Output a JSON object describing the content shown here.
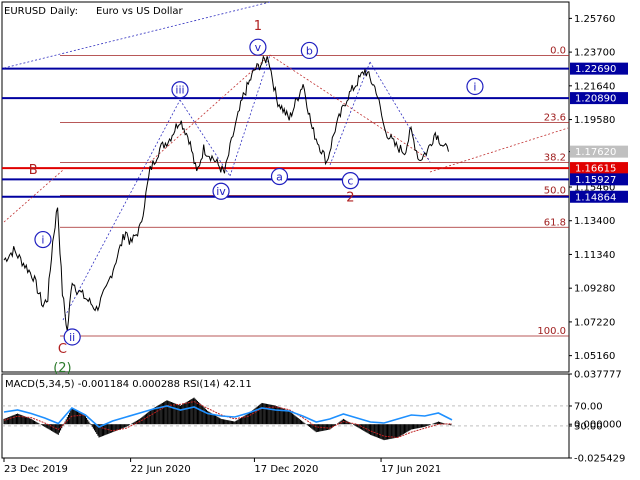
{
  "header": {
    "symbol": "EURUSD",
    "timeframe": "Daily:",
    "description": "Euro vs US Dollar"
  },
  "colors": {
    "bg": "#ffffff",
    "price": "#000000",
    "level_blue": "#0000a0",
    "level_red": "#e00000",
    "fib": "#a02020",
    "wave_blue": "#2020c0",
    "wave_red": "#b02020",
    "wave_green": "#2a7a2a",
    "dotted_blue": "#3030c0",
    "dotted_red": "#c03030",
    "macd_hist": "#000000",
    "signal": "#c02020",
    "rsi": "#1e90ff",
    "label_bg": "#0000a0",
    "label_red_bg": "#e00000",
    "label_gray_bg": "#c0c0c0"
  },
  "chart_data": [
    {
      "type": "line",
      "title": "EURUSD, Daily:  Euro vs US Dollar",
      "x": [
        "23 Dec 2019",
        "22 Jun 2020",
        "17 Dec 2020",
        "17 Jun 2021"
      ],
      "x_ticks": [
        "23 Dec 2019",
        "22 Jun 2020",
        "17 Dec 2020",
        "17 Jun 2021"
      ],
      "y_ticks": [
        "1.25760",
        "1.23700",
        "1.21640",
        "1.19580",
        "1.17620",
        "1.15460",
        "1.13400",
        "1.11340",
        "1.09280",
        "1.07220",
        "1.05160"
      ],
      "ylim": [
        1.0416,
        1.2676
      ],
      "series": [
        {
          "points": [
            [
              "2019-12-23",
              1.11
            ],
            [
              "2020-01-06",
              1.116
            ],
            [
              "2020-01-20",
              1.108
            ],
            [
              "2020-02-03",
              1.1
            ],
            [
              "2020-02-17",
              1.082
            ],
            [
              "2020-02-24",
              1.087
            ],
            [
              "2020-03-02",
              1.121
            ],
            [
              "2020-03-09",
              1.143
            ],
            [
              "2020-03-16",
              1.09
            ],
            [
              "2020-03-23",
              1.066
            ],
            [
              "2020-03-30",
              1.098
            ],
            [
              "2020-04-06",
              1.092
            ],
            [
              "2020-04-20",
              1.086
            ],
            [
              "2020-05-04",
              1.08
            ],
            [
              "2020-05-18",
              1.092
            ],
            [
              "2020-06-01",
              1.11
            ],
            [
              "2020-06-15",
              1.128
            ],
            [
              "2020-06-22",
              1.12
            ],
            [
              "2020-07-06",
              1.13
            ],
            [
              "2020-07-20",
              1.165
            ],
            [
              "2020-08-03",
              1.178
            ],
            [
              "2020-08-17",
              1.184
            ],
            [
              "2020-09-01",
              1.196
            ],
            [
              "2020-09-14",
              1.184
            ],
            [
              "2020-09-25",
              1.163
            ],
            [
              "2020-10-05",
              1.178
            ],
            [
              "2020-10-19",
              1.172
            ],
            [
              "2020-11-04",
              1.163
            ],
            [
              "2020-11-16",
              1.186
            ],
            [
              "2020-12-01",
              1.21
            ],
            [
              "2020-12-17",
              1.226
            ],
            [
              "2021-01-06",
              1.234
            ],
            [
              "2021-01-18",
              1.208
            ],
            [
              "2021-02-05",
              1.196
            ],
            [
              "2021-02-25",
              1.218
            ],
            [
              "2021-03-10",
              1.19
            ],
            [
              "2021-03-31",
              1.17
            ],
            [
              "2021-04-12",
              1.19
            ],
            [
              "2021-04-29",
              1.209
            ],
            [
              "2021-05-25",
              1.226
            ],
            [
              "2021-06-10",
              1.214
            ],
            [
              "2021-06-22",
              1.19
            ],
            [
              "2021-07-07",
              1.18
            ],
            [
              "2021-07-21",
              1.176
            ],
            [
              "2021-07-30",
              1.189
            ],
            [
              "2021-08-11",
              1.171
            ],
            [
              "2021-08-23",
              1.177
            ],
            [
              "2021-09-03",
              1.188
            ],
            [
              "2021-09-14",
              1.18
            ],
            [
              "2021-09-22",
              1.1762
            ]
          ]
        }
      ],
      "levels": [
        {
          "label": "1.22690",
          "value": 1.2269,
          "color": "blue"
        },
        {
          "label": "1.20890",
          "value": 1.2089,
          "color": "blue"
        },
        {
          "label": "1.17620",
          "value": 1.1762,
          "color": "gray"
        },
        {
          "label": "1.16615",
          "value": 1.16615,
          "color": "red"
        },
        {
          "label": "1.15927",
          "value": 1.15927,
          "color": "blue"
        },
        {
          "label": "1.14864",
          "value": 1.14864,
          "color": "blue"
        }
      ],
      "fib_levels": [
        {
          "label": "0.0",
          "value": 1.2349
        },
        {
          "label": "23.6",
          "value": 1.194
        },
        {
          "label": "38.2",
          "value": 1.1695
        },
        {
          "label": "50.0",
          "value": 1.1495
        },
        {
          "label": "61.8",
          "value": 1.13
        },
        {
          "label": "100.0",
          "value": 1.0636
        }
      ],
      "wave_labels": [
        {
          "text": "1",
          "date": "2020-12-22",
          "value": 1.2535,
          "style": "red-plain"
        },
        {
          "text": "v",
          "date": "2020-12-22",
          "value": 1.24,
          "style": "blue-circle"
        },
        {
          "text": "b",
          "date": "2021-03-06",
          "value": 1.238,
          "style": "blue-circle"
        },
        {
          "text": "i",
          "date": "2021-10-30",
          "value": 1.216,
          "style": "blue-circle-open"
        },
        {
          "text": "iii",
          "date": "2020-09-01",
          "value": 1.214,
          "style": "blue-circle"
        },
        {
          "text": "a",
          "date": "2021-01-22",
          "value": 1.161,
          "style": "blue-circle"
        },
        {
          "text": "iv",
          "date": "2020-10-30",
          "value": 1.152,
          "style": "blue-circle"
        },
        {
          "text": "c",
          "date": "2021-05-04",
          "value": 1.1585,
          "style": "blue-circle"
        },
        {
          "text": "2",
          "date": "2021-05-04",
          "value": 1.1485,
          "style": "red-plain"
        },
        {
          "text": "B",
          "date": "2020-02-03",
          "value": 1.1655,
          "style": "red-plain"
        },
        {
          "text": "i",
          "date": "2020-02-17",
          "value": 1.1225,
          "style": "blue-circle"
        },
        {
          "text": "ii",
          "date": "2020-03-30",
          "value": 1.063,
          "style": "blue-circle"
        },
        {
          "text": "C",
          "date": "2020-03-16",
          "value": 1.056,
          "style": "red-plain"
        },
        {
          "text": "(2)",
          "date": "2020-03-16",
          "value": 1.0445,
          "style": "green-plain"
        }
      ]
    },
    {
      "type": "line",
      "title": "MACD(5,34,5) -0.001184 0.000288 RSI(14) 42.11",
      "y_ticks": [
        "0.037777",
        "70.00",
        "0.000000",
        "30.00",
        "-0.025429"
      ],
      "ylim": [
        -0.025429,
        0.037777
      ],
      "series": [
        {
          "name": "MACD",
          "values": [
            0.004,
            0.008,
            0.004,
            -0.002,
            -0.008,
            0.012,
            0.006,
            -0.01,
            -0.006,
            -0.002,
            0.004,
            0.012,
            0.018,
            0.014,
            0.02,
            0.01,
            0.004,
            0.002,
            0.008,
            0.016,
            0.014,
            0.01,
            0.002,
            -0.006,
            -0.004,
            0.004,
            -0.002,
            -0.008,
            -0.012,
            -0.01,
            -0.004,
            -0.002,
            0.002,
            -0.001184
          ]
        },
        {
          "name": "Signal",
          "values": [
            0.003,
            0.006,
            0.005,
            0.001,
            -0.004,
            0.006,
            0.007,
            -0.002,
            -0.005,
            -0.003,
            0.002,
            0.008,
            0.014,
            0.015,
            0.017,
            0.012,
            0.007,
            0.004,
            0.006,
            0.012,
            0.013,
            0.011,
            0.005,
            -0.002,
            -0.003,
            0.002,
            0.0,
            -0.005,
            -0.009,
            -0.01,
            -0.006,
            -0.003,
            0.0,
            0.000288
          ]
        },
        {
          "name": "RSI",
          "values": [
            58,
            62,
            55,
            46,
            35,
            66,
            52,
            28,
            40,
            48,
            56,
            64,
            70,
            62,
            68,
            55,
            50,
            48,
            56,
            66,
            62,
            60,
            50,
            38,
            44,
            54,
            46,
            38,
            36,
            44,
            52,
            50,
            56,
            42.11
          ]
        }
      ]
    }
  ]
}
